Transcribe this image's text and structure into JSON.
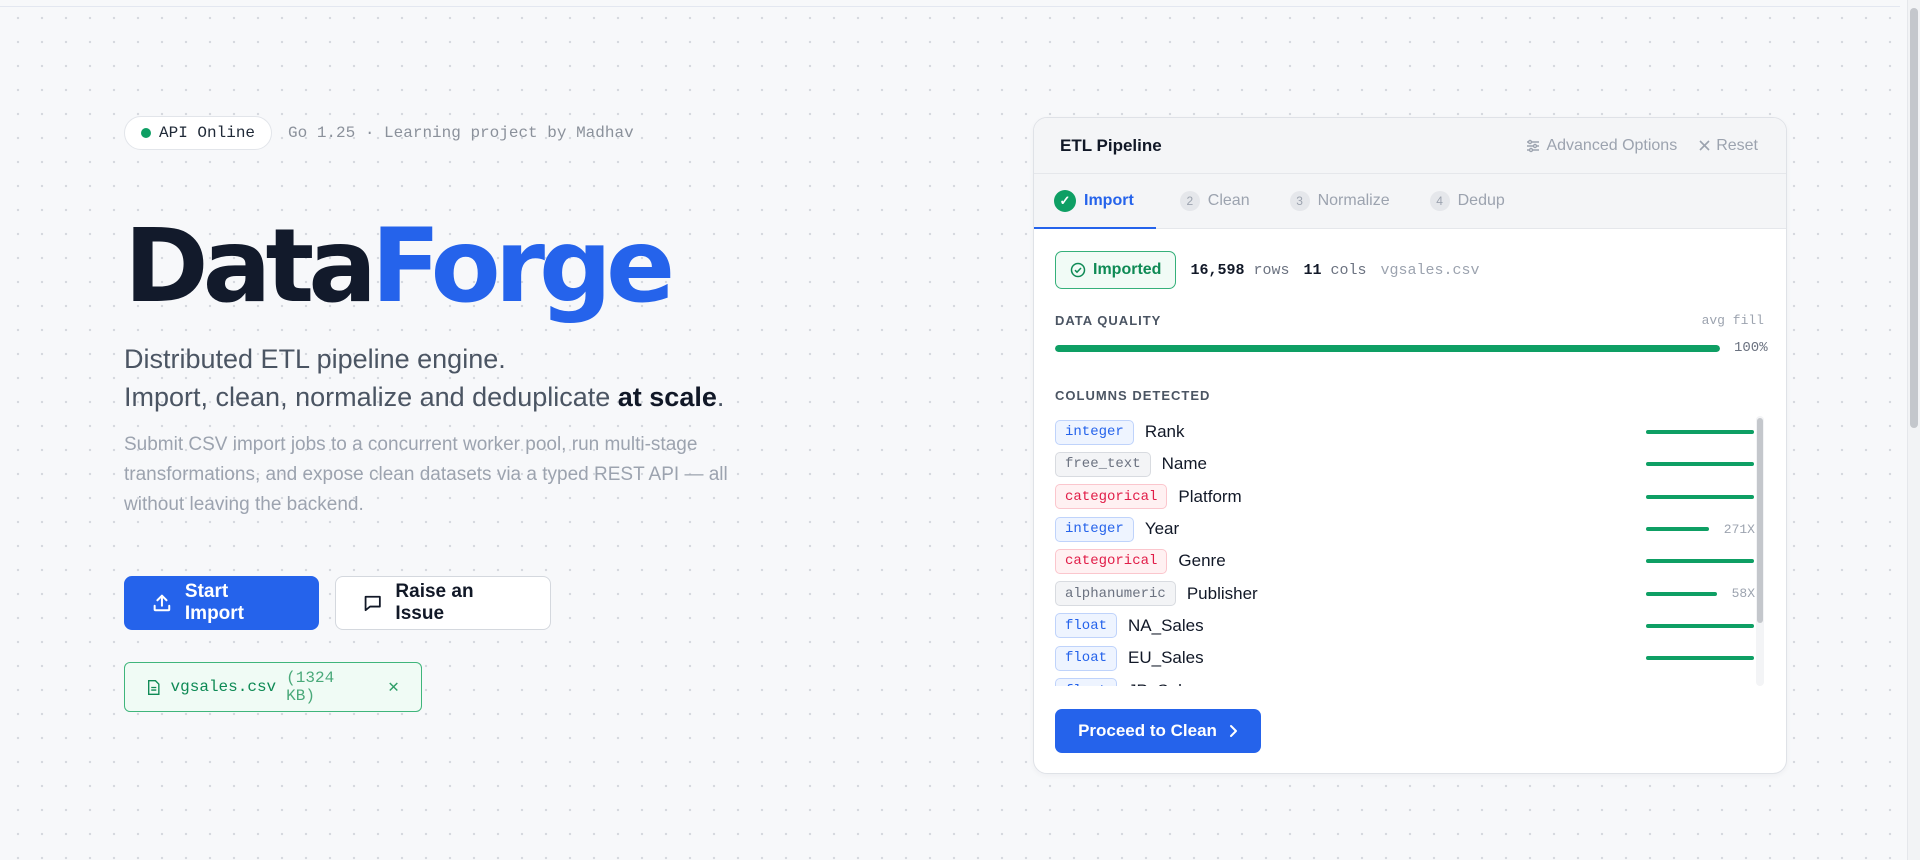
{
  "status": {
    "api_label": "API Online",
    "meta": "Go 1.25 · Learning project by Madhav"
  },
  "brand": {
    "part1": "Data",
    "part2": "Forge"
  },
  "tagline": {
    "line1": "Distributed ETL pipeline engine.",
    "line2_prefix": "Import, clean, normalize and deduplicate ",
    "line2_bold": "at scale",
    "line2_suffix": "."
  },
  "description": "Submit CSV import jobs to a concurrent worker pool, run multi-stage transformations, and expose clean datasets via a typed REST API — all without leaving the backend.",
  "actions": {
    "start_import": "Start Import",
    "raise_issue": "Raise an Issue"
  },
  "file_chip": {
    "name": "vgsales.csv",
    "size": "(1324 KB)",
    "remove": "✕"
  },
  "panel": {
    "title": "ETL Pipeline",
    "advanced_options": "Advanced Options",
    "reset": "Reset",
    "tabs": [
      {
        "num": "✓",
        "label": "Import"
      },
      {
        "num": "2",
        "label": "Clean"
      },
      {
        "num": "3",
        "label": "Normalize"
      },
      {
        "num": "4",
        "label": "Dedup"
      }
    ],
    "imported_label": "Imported",
    "rows_count": "16,598",
    "rows_unit": "rows",
    "cols_count": "11",
    "cols_unit": "cols",
    "file_name": "vgsales.csv",
    "data_quality_label": "DATA QUALITY",
    "avg_fill_label": "avg fill",
    "data_quality_pct": "100%",
    "data_quality_value": 100,
    "columns_label": "COLUMNS DETECTED",
    "columns": [
      {
        "type": "integer",
        "name": "Rank",
        "fill": 100,
        "cardinality": ""
      },
      {
        "type": "free_text",
        "name": "Name",
        "fill": 100,
        "cardinality": ""
      },
      {
        "type": "categorical",
        "name": "Platform",
        "fill": 100,
        "cardinality": ""
      },
      {
        "type": "integer",
        "name": "Year",
        "fill": 58,
        "cardinality": "271X"
      },
      {
        "type": "categorical",
        "name": "Genre",
        "fill": 100,
        "cardinality": ""
      },
      {
        "type": "alphanumeric",
        "name": "Publisher",
        "fill": 66,
        "cardinality": "58X"
      },
      {
        "type": "float",
        "name": "NA_Sales",
        "fill": 100,
        "cardinality": ""
      },
      {
        "type": "float",
        "name": "EU_Sales",
        "fill": 100,
        "cardinality": ""
      },
      {
        "type": "float",
        "name": "JP_Sales",
        "fill": 100,
        "cardinality": ""
      }
    ],
    "proceed_label": "Proceed to Clean"
  },
  "colors": {
    "accent": "#2563eb",
    "success": "#0e9f64",
    "categorical": "#e11d48"
  }
}
